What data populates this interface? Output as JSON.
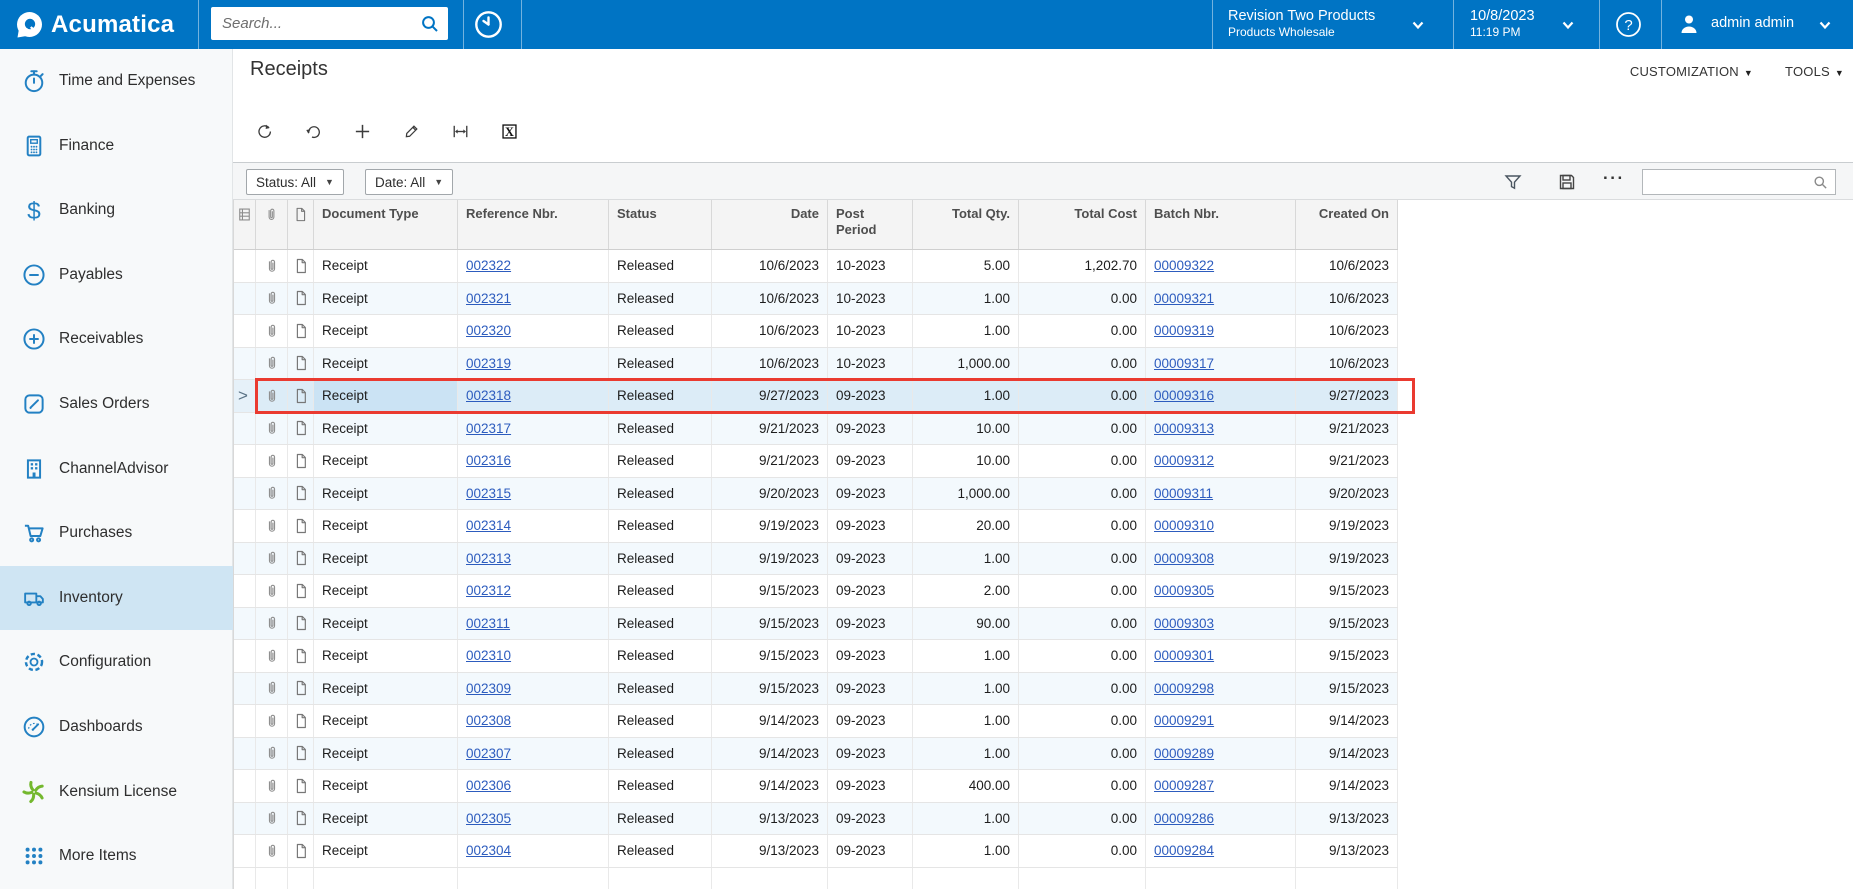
{
  "topbar": {
    "brand": "Acumatica",
    "search_placeholder": "Search...",
    "company": {
      "name": "Revision Two Products",
      "branch": "Products Wholesale"
    },
    "business_date": "10/8/2023",
    "business_time": "11:19 PM",
    "user": "admin admin"
  },
  "sidebar": {
    "selected": "Inventory",
    "items": [
      {
        "label": "Time and Expenses",
        "icon": "stopwatch-icon"
      },
      {
        "label": "Finance",
        "icon": "calculator-icon"
      },
      {
        "label": "Banking",
        "icon": "dollar-icon"
      },
      {
        "label": "Payables",
        "icon": "minus-circle-icon"
      },
      {
        "label": "Receivables",
        "icon": "plus-circle-icon"
      },
      {
        "label": "Sales Orders",
        "icon": "pencil-square-icon"
      },
      {
        "label": "ChannelAdvisor",
        "icon": "building-icon"
      },
      {
        "label": "Purchases",
        "icon": "cart-icon"
      },
      {
        "label": "Inventory",
        "icon": "truck-icon"
      },
      {
        "label": "Configuration",
        "icon": "gear-icon"
      },
      {
        "label": "Dashboards",
        "icon": "gauge-icon"
      },
      {
        "label": "Kensium License",
        "icon": "pinwheel-icon"
      },
      {
        "label": "More Items",
        "icon": "grid-dots-icon"
      }
    ]
  },
  "page": {
    "title": "Receipts",
    "customization_label": "CUSTOMIZATION",
    "tools_label": "TOOLS",
    "toolbar_icons": [
      "refresh-icon",
      "undo-icon",
      "add-icon",
      "edit-icon",
      "fit-width-icon",
      "export-excel-icon"
    ]
  },
  "filter": {
    "status_label": "Status: All",
    "date_label": "Date: All",
    "search_value": ""
  },
  "grid": {
    "columns": [
      "Document Type",
      "Reference Nbr.",
      "Status",
      "Date",
      "Post Period",
      "Total Qty.",
      "Total Cost",
      "Batch Nbr.",
      "Created On"
    ],
    "selected_ref": "002318",
    "rows": [
      [
        "Receipt",
        "002322",
        "Released",
        "10/6/2023",
        "10-2023",
        "5.00",
        "1,202.70",
        "00009322",
        "10/6/2023"
      ],
      [
        "Receipt",
        "002321",
        "Released",
        "10/6/2023",
        "10-2023",
        "1.00",
        "0.00",
        "00009321",
        "10/6/2023"
      ],
      [
        "Receipt",
        "002320",
        "Released",
        "10/6/2023",
        "10-2023",
        "1.00",
        "0.00",
        "00009319",
        "10/6/2023"
      ],
      [
        "Receipt",
        "002319",
        "Released",
        "10/6/2023",
        "10-2023",
        "1,000.00",
        "0.00",
        "00009317",
        "10/6/2023"
      ],
      [
        "Receipt",
        "002318",
        "Released",
        "9/27/2023",
        "09-2023",
        "1.00",
        "0.00",
        "00009316",
        "9/27/2023"
      ],
      [
        "Receipt",
        "002317",
        "Released",
        "9/21/2023",
        "09-2023",
        "10.00",
        "0.00",
        "00009313",
        "9/21/2023"
      ],
      [
        "Receipt",
        "002316",
        "Released",
        "9/21/2023",
        "09-2023",
        "10.00",
        "0.00",
        "00009312",
        "9/21/2023"
      ],
      [
        "Receipt",
        "002315",
        "Released",
        "9/20/2023",
        "09-2023",
        "1,000.00",
        "0.00",
        "00009311",
        "9/20/2023"
      ],
      [
        "Receipt",
        "002314",
        "Released",
        "9/19/2023",
        "09-2023",
        "20.00",
        "0.00",
        "00009310",
        "9/19/2023"
      ],
      [
        "Receipt",
        "002313",
        "Released",
        "9/19/2023",
        "09-2023",
        "1.00",
        "0.00",
        "00009308",
        "9/19/2023"
      ],
      [
        "Receipt",
        "002312",
        "Released",
        "9/15/2023",
        "09-2023",
        "2.00",
        "0.00",
        "00009305",
        "9/15/2023"
      ],
      [
        "Receipt",
        "002311",
        "Released",
        "9/15/2023",
        "09-2023",
        "90.00",
        "0.00",
        "00009303",
        "9/15/2023"
      ],
      [
        "Receipt",
        "002310",
        "Released",
        "9/15/2023",
        "09-2023",
        "1.00",
        "0.00",
        "00009301",
        "9/15/2023"
      ],
      [
        "Receipt",
        "002309",
        "Released",
        "9/15/2023",
        "09-2023",
        "1.00",
        "0.00",
        "00009298",
        "9/15/2023"
      ],
      [
        "Receipt",
        "002308",
        "Released",
        "9/14/2023",
        "09-2023",
        "1.00",
        "0.00",
        "00009291",
        "9/14/2023"
      ],
      [
        "Receipt",
        "002307",
        "Released",
        "9/14/2023",
        "09-2023",
        "1.00",
        "0.00",
        "00009289",
        "9/14/2023"
      ],
      [
        "Receipt",
        "002306",
        "Released",
        "9/14/2023",
        "09-2023",
        "400.00",
        "0.00",
        "00009287",
        "9/14/2023"
      ],
      [
        "Receipt",
        "002305",
        "Released",
        "9/13/2023",
        "09-2023",
        "1.00",
        "0.00",
        "00009286",
        "9/13/2023"
      ],
      [
        "Receipt",
        "002304",
        "Released",
        "9/13/2023",
        "09-2023",
        "1.00",
        "0.00",
        "00009284",
        "9/13/2023"
      ]
    ]
  }
}
